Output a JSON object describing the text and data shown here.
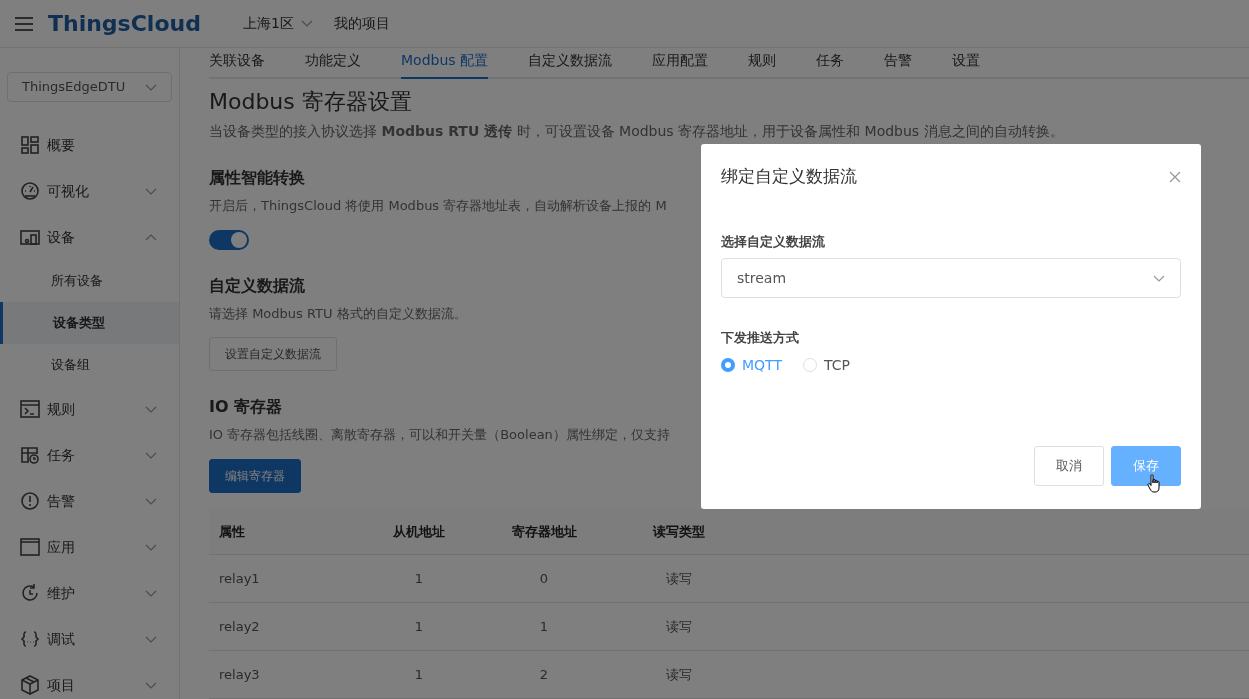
{
  "header": {
    "brand": "ThingsCloud",
    "region": "上海1区",
    "project": "我的项目"
  },
  "sidebar": {
    "device_select": "ThingsEdgeDTU",
    "items": [
      {
        "label": "概要"
      },
      {
        "label": "可视化",
        "expanded": false
      },
      {
        "label": "设备",
        "expanded": true,
        "children": [
          {
            "label": "所有设备",
            "selected": false
          },
          {
            "label": "设备类型",
            "selected": true
          },
          {
            "label": "设备组",
            "selected": false
          }
        ]
      },
      {
        "label": "规则",
        "expanded": false
      },
      {
        "label": "任务",
        "expanded": false
      },
      {
        "label": "告警",
        "expanded": false
      },
      {
        "label": "应用",
        "expanded": false
      },
      {
        "label": "维护",
        "expanded": false
      },
      {
        "label": "调试",
        "expanded": false
      },
      {
        "label": "项目",
        "expanded": false
      }
    ]
  },
  "tabs": [
    {
      "label": "关联设备",
      "selected": false
    },
    {
      "label": "功能定义",
      "selected": false
    },
    {
      "label": "Modbus 配置",
      "selected": true
    },
    {
      "label": "自定义数据流",
      "selected": false
    },
    {
      "label": "应用配置",
      "selected": false
    },
    {
      "label": "规则",
      "selected": false
    },
    {
      "label": "任务",
      "selected": false
    },
    {
      "label": "告警",
      "selected": false
    },
    {
      "label": "设置",
      "selected": false
    }
  ],
  "page": {
    "title": "Modbus 寄存器设置",
    "description": "当设备类型的接入协议选择 **Modbus RTU 透传** 时，可设置设备 Modbus 寄存器地址，用于设备属性和 Modbus 消息之间的自动转换。",
    "sections": [
      {
        "kind": "toggle",
        "title": "属性智能转换",
        "description": "开启后，ThingsCloud 将使用 Modbus 寄存器地址表，自动解析设备上报的 M",
        "on": true
      },
      {
        "kind": "button",
        "title": "自定义数据流",
        "description": "请选择 Modbus RTU 格式的自定义数据流。",
        "button": "设置自定义数据流",
        "primary": false
      },
      {
        "kind": "button",
        "title": "IO 寄存器",
        "description": "IO 寄存器包括线圈、离散寄存器，可以和开关量（Boolean）属性绑定，仅支持",
        "button": "编辑寄存器",
        "primary": true
      }
    ],
    "table": {
      "columns": [
        "属性",
        "从机地址",
        "寄存器地址",
        "读写类型"
      ],
      "rows": [
        [
          "relay1",
          "1",
          "0",
          "读写"
        ],
        [
          "relay2",
          "1",
          "1",
          "读写"
        ],
        [
          "relay3",
          "1",
          "2",
          "读写"
        ]
      ]
    }
  },
  "modal": {
    "title": "绑定自定义数据流",
    "select_label": "选择自定义数据流",
    "select_value": "stream",
    "radio_label": "下发推送方式",
    "radios": [
      {
        "label": "MQTT",
        "selected": true
      },
      {
        "label": "TCP",
        "selected": false
      }
    ],
    "cancel": "取消",
    "save": "保存"
  }
}
